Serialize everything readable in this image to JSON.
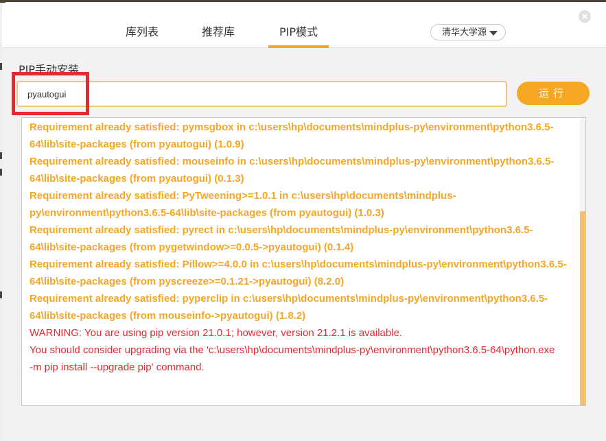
{
  "tabs": [
    {
      "label": "库列表",
      "active": false
    },
    {
      "label": "推荐库",
      "active": false
    },
    {
      "label": "PIP模式",
      "active": true
    }
  ],
  "source_select": {
    "value": "清华大学源"
  },
  "close_icon": "close-icon",
  "section_title": "PIP手动安装",
  "package_input": {
    "value": "pyautogui",
    "placeholder": ""
  },
  "run_button": {
    "label": "运行"
  },
  "accent_color": "#f5a623",
  "warning_color": "#e8282d",
  "output_lines": [
    {
      "text": "Requirement already satisfied: pymsgbox in c:\\users\\hp\\documents\\mindplus-py\\environment\\python3.6.5-",
      "kind": "info"
    },
    {
      "text": "64\\lib\\site-packages (from pyautogui) (1.0.9)",
      "kind": "info"
    },
    {
      "text": "Requirement already satisfied: mouseinfo in c:\\users\\hp\\documents\\mindplus-py\\environment\\python3.6.5-",
      "kind": "info"
    },
    {
      "text": "64\\lib\\site-packages (from pyautogui) (0.1.3)",
      "kind": "info"
    },
    {
      "text": "Requirement already satisfied: PyTweening>=1.0.1 in c:\\users\\hp\\documents\\mindplus-",
      "kind": "info"
    },
    {
      "text": "py\\environment\\python3.6.5-64\\lib\\site-packages (from pyautogui) (1.0.3)",
      "kind": "info"
    },
    {
      "text": "Requirement already satisfied: pyrect in c:\\users\\hp\\documents\\mindplus-py\\environment\\python3.6.5-",
      "kind": "info"
    },
    {
      "text": "64\\lib\\site-packages (from pygetwindow>=0.0.5->pyautogui) (0.1.4)",
      "kind": "info"
    },
    {
      "text": "Requirement already satisfied: Pillow>=4.0.0 in c:\\users\\hp\\documents\\mindplus-py\\environment\\python3.6.5-",
      "kind": "info"
    },
    {
      "text": "64\\lib\\site-packages (from pyscreeze>=0.1.21->pyautogui) (8.2.0)",
      "kind": "info"
    },
    {
      "text": "Requirement already satisfied: pyperclip in c:\\users\\hp\\documents\\mindplus-py\\environment\\python3.6.5-",
      "kind": "info"
    },
    {
      "text": "64\\lib\\site-packages (from mouseinfo->pyautogui) (1.8.2)",
      "kind": "info"
    },
    {
      "text": "WARNING: You are using pip version 21.0.1; however, version 21.2.1 is available.",
      "kind": "warn"
    },
    {
      "text": "You should consider upgrading via the 'c:\\users\\hp\\documents\\mindplus-py\\environment\\python3.6.5-64\\python.exe",
      "kind": "warn"
    },
    {
      "text": "-m pip install --upgrade pip' command.",
      "kind": "warn"
    }
  ]
}
